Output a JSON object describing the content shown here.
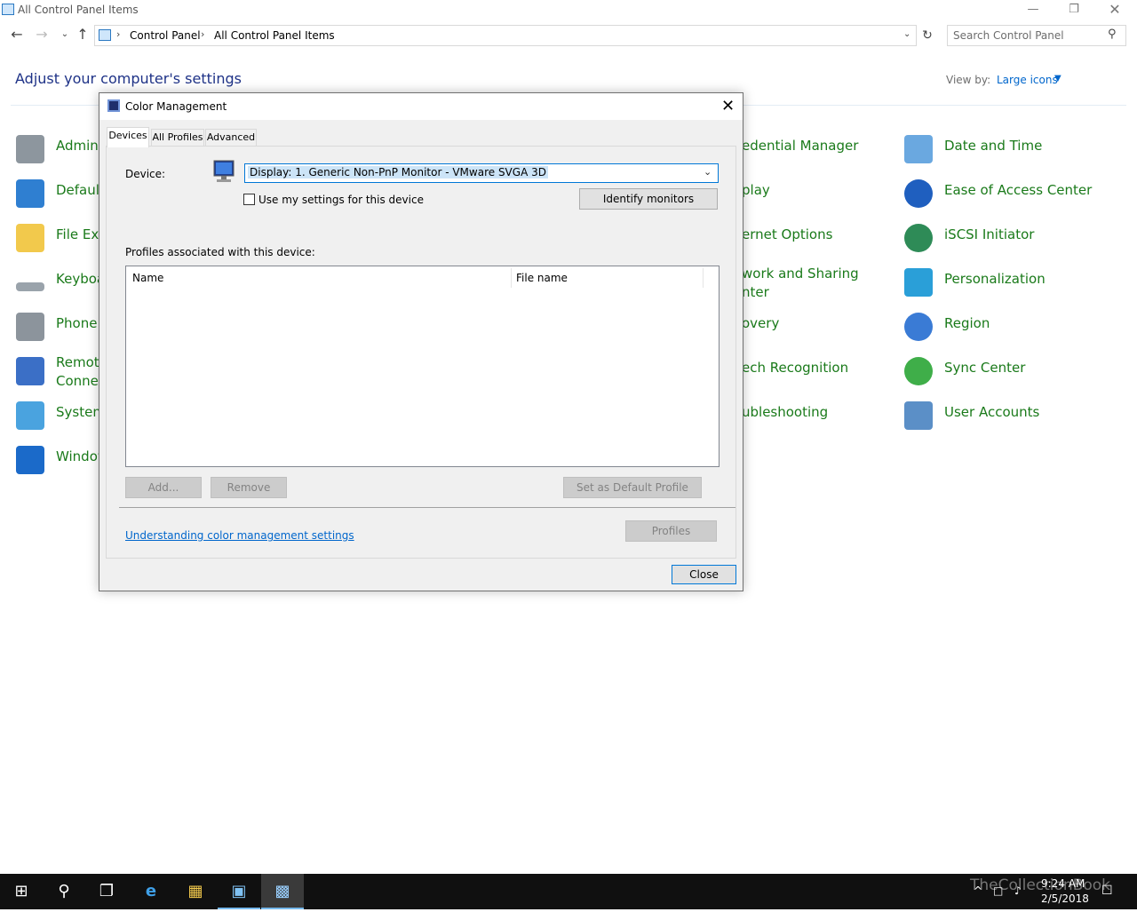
{
  "window": {
    "title": "All Control Panel Items",
    "minimize": "—",
    "maximize": "❐",
    "close": "✕"
  },
  "address": {
    "crumbs": [
      "Control Panel",
      "All Control Panel Items"
    ],
    "search_placeholder": "Search Control Panel"
  },
  "main": {
    "heading": "Adjust your computer's settings",
    "view_by_label": "View by:",
    "view_by_value": "Large icons"
  },
  "items_left": [
    {
      "label": "Admini",
      "icon": "admin-tools-icon",
      "color": "#7f8c97"
    },
    {
      "label": "Default",
      "icon": "default-programs-icon",
      "color": "#2f7fd1"
    },
    {
      "label": "File Exp",
      "icon": "file-explorer-options-icon",
      "color": "#f2c94c"
    },
    {
      "label": "Keyboa",
      "icon": "keyboard-icon",
      "color": "#9aa3ab"
    },
    {
      "label": "Phone",
      "icon": "phone-modem-icon",
      "color": "#8c949c"
    },
    {
      "label": "Remote\nConnec",
      "icon": "remoteapp-icon",
      "color": "#3b6fc6"
    },
    {
      "label": "System",
      "icon": "system-icon",
      "color": "#4aa3df"
    },
    {
      "label": "Window",
      "icon": "windows-firewall-icon",
      "color": "#1b6ac9"
    }
  ],
  "items_mid": [
    {
      "label": "edential Manager"
    },
    {
      "label": "play"
    },
    {
      "label": "ernet Options"
    },
    {
      "label": "work and Sharing\nnter"
    },
    {
      "label": "overy"
    },
    {
      "label": "ech Recognition"
    },
    {
      "label": "ubleshooting"
    }
  ],
  "items_right": [
    {
      "label": "Date and Time",
      "icon": "date-time-icon",
      "color": "#6aa8e0"
    },
    {
      "label": "Ease of Access Center",
      "icon": "ease-of-access-icon",
      "color": "#1f5fbf"
    },
    {
      "label": "iSCSI Initiator",
      "icon": "iscsi-initiator-icon",
      "color": "#2e8b57"
    },
    {
      "label": "Personalization",
      "icon": "personalization-icon",
      "color": "#2a9fd8"
    },
    {
      "label": "Region",
      "icon": "region-icon",
      "color": "#3a7bd5"
    },
    {
      "label": "Sync Center",
      "icon": "sync-center-icon",
      "color": "#3fae49"
    },
    {
      "label": "User Accounts",
      "icon": "user-accounts-icon",
      "color": "#5b8fc7"
    }
  ],
  "dialog": {
    "title": "Color Management",
    "tabs": [
      "Devices",
      "All Profiles",
      "Advanced"
    ],
    "device_label": "Device:",
    "device_value": "Display: 1. Generic Non-PnP Monitor - VMware SVGA 3D",
    "use_settings_label": "Use my settings for this device",
    "identify_button": "Identify monitors",
    "profiles_label": "Profiles associated with this device:",
    "columns": [
      "Name",
      "File name"
    ],
    "add_button": "Add...",
    "remove_button": "Remove",
    "set_default_button": "Set as Default Profile",
    "link": "Understanding color management settings",
    "profiles_button": "Profiles",
    "close_button": "Close"
  },
  "taskbar": {
    "time": "9:24 AM",
    "date": "2/5/2018",
    "watermark": "TheCollectionBook"
  }
}
